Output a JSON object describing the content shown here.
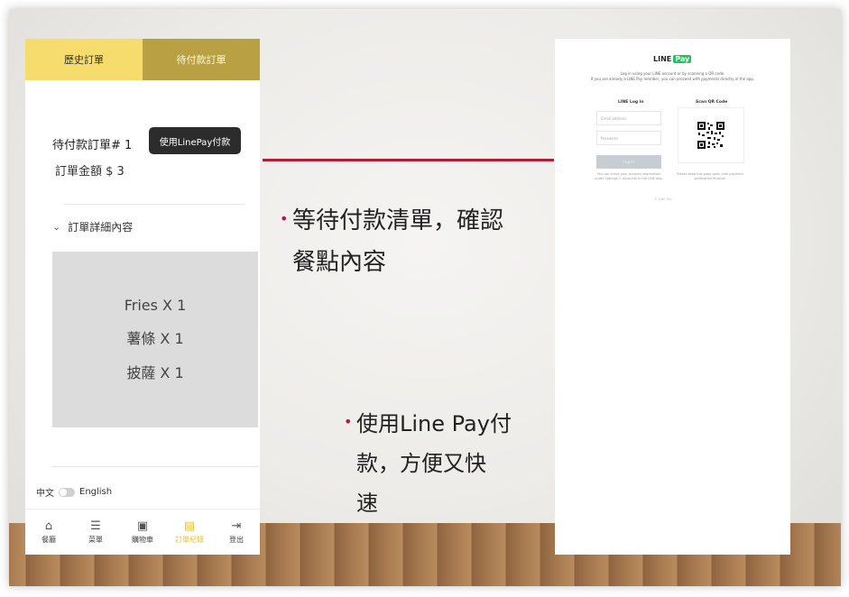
{
  "app": {
    "tabs": [
      {
        "label": "歷史訂單"
      },
      {
        "label": "待付款訂單"
      }
    ],
    "order": {
      "title": "待付款訂單# 1",
      "amount": "訂單金額 $ 3",
      "pay_button": "使用LinePay付款",
      "details_label": "訂單詳細內容",
      "items": [
        "Fries X 1",
        "薯條 X 1",
        "披薩 X 1"
      ]
    },
    "language": {
      "left": "中文",
      "right": "English"
    },
    "nav": [
      {
        "label": "餐廳",
        "icon": "home-icon"
      },
      {
        "label": "菜單",
        "icon": "menu-icon"
      },
      {
        "label": "購物車",
        "icon": "cart-icon"
      },
      {
        "label": "訂單紀錄",
        "icon": "order-record-icon"
      },
      {
        "label": "登出",
        "icon": "logout-icon"
      }
    ],
    "accent_color": "#f6dc6c"
  },
  "slide": {
    "bullet1": [
      "等待付款清單，確認",
      "餐點內容"
    ],
    "bullet2": [
      "使用Line Pay付",
      "款，方便又快",
      "速"
    ],
    "line_color": "#b01e35"
  },
  "linepay": {
    "logo_line": "LINE",
    "logo_pay": "Pay",
    "description": [
      "Log in using your LINE account or by scanning a QR code.",
      "If you are already a LINE Pay member, you can proceed with payments directly in the app."
    ],
    "login_heading": "LINE Log in",
    "qr_heading": "Scan QR Code",
    "email_placeholder": "Email address",
    "password_placeholder": "Password",
    "login_button": "Log in",
    "login_note": "You can check your account information under Settings > Accounts in the LINE app.",
    "qr_note": "Please keep this page open until payment verification finishes.",
    "footer": "© LINE Pay"
  }
}
